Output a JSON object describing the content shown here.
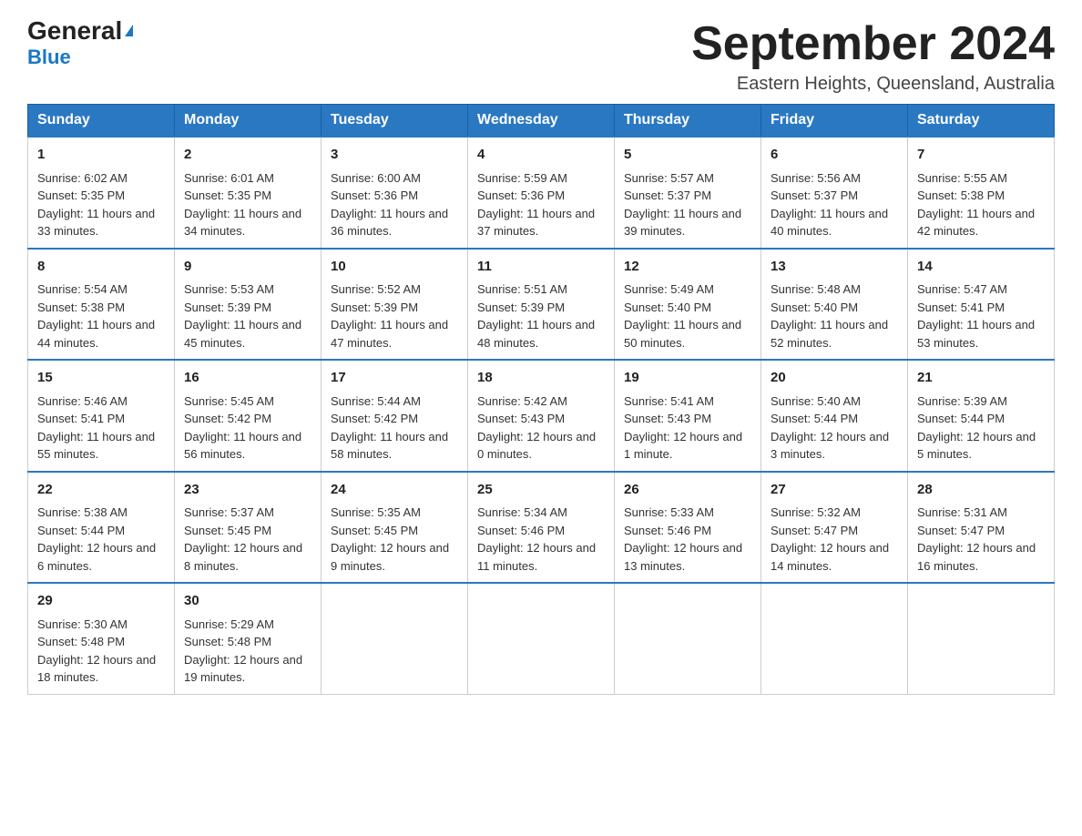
{
  "logo": {
    "general": "General",
    "arrow": "▶",
    "blue": "Blue"
  },
  "title": "September 2024",
  "subtitle": "Eastern Heights, Queensland, Australia",
  "weekdays": [
    "Sunday",
    "Monday",
    "Tuesday",
    "Wednesday",
    "Thursday",
    "Friday",
    "Saturday"
  ],
  "weeks": [
    [
      {
        "day": "1",
        "sunrise": "6:02 AM",
        "sunset": "5:35 PM",
        "daylight": "11 hours and 33 minutes."
      },
      {
        "day": "2",
        "sunrise": "6:01 AM",
        "sunset": "5:35 PM",
        "daylight": "11 hours and 34 minutes."
      },
      {
        "day": "3",
        "sunrise": "6:00 AM",
        "sunset": "5:36 PM",
        "daylight": "11 hours and 36 minutes."
      },
      {
        "day": "4",
        "sunrise": "5:59 AM",
        "sunset": "5:36 PM",
        "daylight": "11 hours and 37 minutes."
      },
      {
        "day": "5",
        "sunrise": "5:57 AM",
        "sunset": "5:37 PM",
        "daylight": "11 hours and 39 minutes."
      },
      {
        "day": "6",
        "sunrise": "5:56 AM",
        "sunset": "5:37 PM",
        "daylight": "11 hours and 40 minutes."
      },
      {
        "day": "7",
        "sunrise": "5:55 AM",
        "sunset": "5:38 PM",
        "daylight": "11 hours and 42 minutes."
      }
    ],
    [
      {
        "day": "8",
        "sunrise": "5:54 AM",
        "sunset": "5:38 PM",
        "daylight": "11 hours and 44 minutes."
      },
      {
        "day": "9",
        "sunrise": "5:53 AM",
        "sunset": "5:39 PM",
        "daylight": "11 hours and 45 minutes."
      },
      {
        "day": "10",
        "sunrise": "5:52 AM",
        "sunset": "5:39 PM",
        "daylight": "11 hours and 47 minutes."
      },
      {
        "day": "11",
        "sunrise": "5:51 AM",
        "sunset": "5:39 PM",
        "daylight": "11 hours and 48 minutes."
      },
      {
        "day": "12",
        "sunrise": "5:49 AM",
        "sunset": "5:40 PM",
        "daylight": "11 hours and 50 minutes."
      },
      {
        "day": "13",
        "sunrise": "5:48 AM",
        "sunset": "5:40 PM",
        "daylight": "11 hours and 52 minutes."
      },
      {
        "day": "14",
        "sunrise": "5:47 AM",
        "sunset": "5:41 PM",
        "daylight": "11 hours and 53 minutes."
      }
    ],
    [
      {
        "day": "15",
        "sunrise": "5:46 AM",
        "sunset": "5:41 PM",
        "daylight": "11 hours and 55 minutes."
      },
      {
        "day": "16",
        "sunrise": "5:45 AM",
        "sunset": "5:42 PM",
        "daylight": "11 hours and 56 minutes."
      },
      {
        "day": "17",
        "sunrise": "5:44 AM",
        "sunset": "5:42 PM",
        "daylight": "11 hours and 58 minutes."
      },
      {
        "day": "18",
        "sunrise": "5:42 AM",
        "sunset": "5:43 PM",
        "daylight": "12 hours and 0 minutes."
      },
      {
        "day": "19",
        "sunrise": "5:41 AM",
        "sunset": "5:43 PM",
        "daylight": "12 hours and 1 minute."
      },
      {
        "day": "20",
        "sunrise": "5:40 AM",
        "sunset": "5:44 PM",
        "daylight": "12 hours and 3 minutes."
      },
      {
        "day": "21",
        "sunrise": "5:39 AM",
        "sunset": "5:44 PM",
        "daylight": "12 hours and 5 minutes."
      }
    ],
    [
      {
        "day": "22",
        "sunrise": "5:38 AM",
        "sunset": "5:44 PM",
        "daylight": "12 hours and 6 minutes."
      },
      {
        "day": "23",
        "sunrise": "5:37 AM",
        "sunset": "5:45 PM",
        "daylight": "12 hours and 8 minutes."
      },
      {
        "day": "24",
        "sunrise": "5:35 AM",
        "sunset": "5:45 PM",
        "daylight": "12 hours and 9 minutes."
      },
      {
        "day": "25",
        "sunrise": "5:34 AM",
        "sunset": "5:46 PM",
        "daylight": "12 hours and 11 minutes."
      },
      {
        "day": "26",
        "sunrise": "5:33 AM",
        "sunset": "5:46 PM",
        "daylight": "12 hours and 13 minutes."
      },
      {
        "day": "27",
        "sunrise": "5:32 AM",
        "sunset": "5:47 PM",
        "daylight": "12 hours and 14 minutes."
      },
      {
        "day": "28",
        "sunrise": "5:31 AM",
        "sunset": "5:47 PM",
        "daylight": "12 hours and 16 minutes."
      }
    ],
    [
      {
        "day": "29",
        "sunrise": "5:30 AM",
        "sunset": "5:48 PM",
        "daylight": "12 hours and 18 minutes."
      },
      {
        "day": "30",
        "sunrise": "5:29 AM",
        "sunset": "5:48 PM",
        "daylight": "12 hours and 19 minutes."
      },
      null,
      null,
      null,
      null,
      null
    ]
  ]
}
